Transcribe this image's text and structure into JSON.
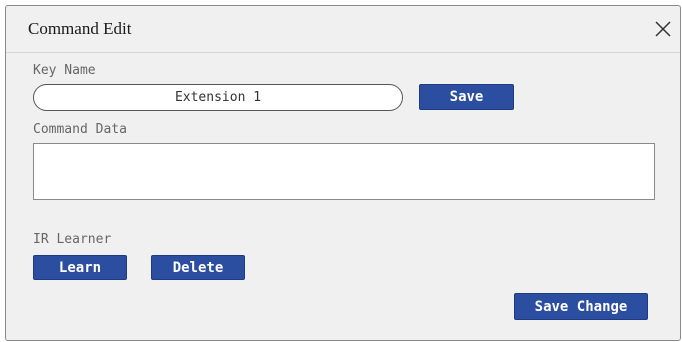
{
  "dialog": {
    "title": "Command Edit",
    "close_icon": "close-icon"
  },
  "key_name": {
    "label": "Key Name",
    "value": "Extension 1",
    "save_label": "Save"
  },
  "command_data": {
    "label": "Command Data",
    "value": ""
  },
  "ir_learner": {
    "label": "IR Learner",
    "learn_label": "Learn",
    "delete_label": "Delete"
  },
  "footer": {
    "save_change_label": "Save Change"
  },
  "colors": {
    "button_bg": "#2c4ea0",
    "button_text": "#ffffff",
    "dialog_bg": "#f0f0f0"
  }
}
